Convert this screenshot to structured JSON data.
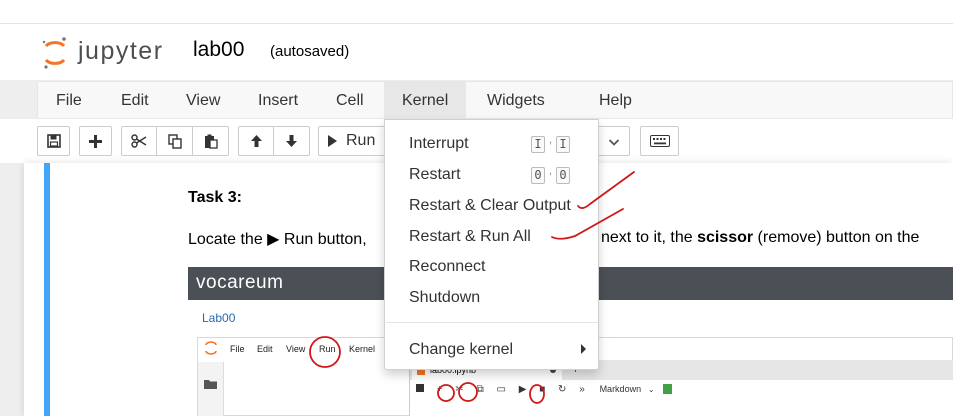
{
  "header": {
    "logo_text": "jupyter",
    "notebook_name": "lab00",
    "autosave_status": "(autosaved)"
  },
  "menubar": {
    "items": [
      "File",
      "Edit",
      "View",
      "Insert",
      "Cell",
      "Kernel",
      "Widgets",
      "Help"
    ],
    "active": "Kernel"
  },
  "toolbar": {
    "run_label": "Run",
    "icons": [
      "save-icon",
      "plus-icon",
      "scissors-icon",
      "copy-icon",
      "paste-icon",
      "arrow-up-icon",
      "arrow-down-icon",
      "play-icon",
      "chevron-down-icon",
      "keyboard-icon"
    ]
  },
  "kernel_menu": {
    "items": [
      {
        "label": "Interrupt",
        "shortcut": [
          "I",
          "I"
        ]
      },
      {
        "label": "Restart",
        "shortcut": [
          "0",
          "0"
        ]
      },
      {
        "label": "Restart & Clear Output"
      },
      {
        "label": "Restart & Run All"
      },
      {
        "label": "Reconnect"
      },
      {
        "label": "Shutdown"
      },
      {
        "label": "Change kernel"
      }
    ]
  },
  "cell": {
    "task_heading": "Task 3:",
    "para_start": "Locate the ▶ Run button,",
    "para_mid": "next to it, the ",
    "para_bold": "scissor",
    "para_end": " (remove) button on the"
  },
  "embedded_image": {
    "brand": "vocareum",
    "link": "Lab00",
    "menu": [
      "File",
      "Edit",
      "View",
      "Run",
      "Kernel"
    ],
    "tab_name": "lab00.ipynb",
    "cell_type": "Markdown"
  },
  "colors": {
    "accent_blue": "#42a5f5",
    "jupyter_orange": "#f37626",
    "annotation_red": "#d01818",
    "vocareum_band": "#4a5056"
  }
}
